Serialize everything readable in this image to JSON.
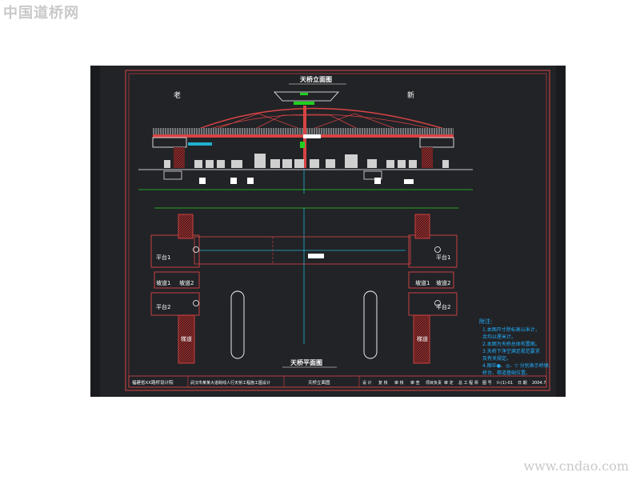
{
  "watermark_top": "中国道桥网",
  "watermark_bottom": "www.cndao.com",
  "drawing": {
    "elevation_title": "天桥立面图",
    "plan_title": "天桥平面图",
    "left_label": "老",
    "right_label": "新",
    "labels_left": [
      "平台1",
      "坡道1",
      "坡道2",
      "平台2",
      "梯道"
    ],
    "labels_right": [
      "平台1",
      "坡道1",
      "坡道2",
      "平台2",
      "梯道"
    ],
    "notes_title": "附注:",
    "notes": [
      "1.本图尺寸除标高以米计，",
      "  余均以厘米计。",
      "2.本图为天桥总体布置图。",
      "3.天桥下净空满足规范要求",
      "  及有关规定。",
      "4.图中●、◎、▽ 分别表示桥墩、",
      "  桥台、梯道基础位置。"
    ]
  },
  "title_block": {
    "company": "福建省XX路桥设计院",
    "project": "武汉市某某大道跨线人行天桥工程施工图设计",
    "drawing_name": "天桥立面图",
    "fields": [
      "设 计",
      "复 核",
      "审 核",
      "审 查",
      "项目负责",
      "审 定",
      "总 工 程 师",
      "图 号",
      "II-(1)-01",
      "日 期",
      "2004.7"
    ]
  }
}
